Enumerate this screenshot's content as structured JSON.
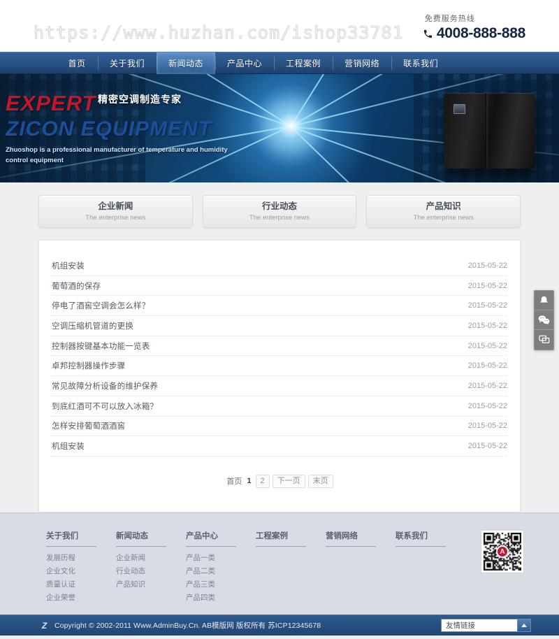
{
  "header": {
    "watermark": "https://www.huzhan.com/ishop33781",
    "hotline_label": "免费服务热线",
    "hotline_number": "4008-888-888",
    "phone_icon": "phone-icon"
  },
  "nav": {
    "items": [
      {
        "label": "首页",
        "active": false
      },
      {
        "label": "关于我们",
        "active": false
      },
      {
        "label": "新闻动态",
        "active": true
      },
      {
        "label": "产品中心",
        "active": false
      },
      {
        "label": "工程案例",
        "active": false
      },
      {
        "label": "营销网络",
        "active": false
      },
      {
        "label": "联系我们",
        "active": false
      }
    ]
  },
  "banner": {
    "headline_red": "EXPERT",
    "headline_blue": "ZICON EQUIPMENT",
    "slogan_cn": "精密空调制造专家",
    "slogan_en": "Zhuoshop is a professional manufacturer of temperature and humidity control equipment"
  },
  "categories": [
    {
      "title": "企业新闻",
      "subtitle": "The enterprise news"
    },
    {
      "title": "行业动态",
      "subtitle": "The enterprise news"
    },
    {
      "title": "产品知识",
      "subtitle": "The enterprise news"
    }
  ],
  "news": {
    "items": [
      {
        "title": "机组安装",
        "date": "2015-05-22"
      },
      {
        "title": "葡萄酒的保存",
        "date": "2015-05-22"
      },
      {
        "title": "停电了酒窖空调会怎么样？",
        "date": "2015-05-22"
      },
      {
        "title": "空调压缩机管道的更换",
        "date": "2015-05-22"
      },
      {
        "title": "控制器按键基本功能一览表",
        "date": "2015-05-22"
      },
      {
        "title": "卓邦控制器操作步骤",
        "date": "2015-05-22"
      },
      {
        "title": "常见故障分析设备的维护保养",
        "date": "2015-05-22"
      },
      {
        "title": "到底红酒可不可以放入冰箱？",
        "date": "2015-05-22"
      },
      {
        "title": "怎样安排葡萄酒酒窖",
        "date": "2015-05-22"
      },
      {
        "title": "机组安装",
        "date": "2015-05-22"
      }
    ]
  },
  "pagination": {
    "first": "首页",
    "current": "1",
    "page2": "2",
    "next": "下一页",
    "last": "末页"
  },
  "side_widget": {
    "items": [
      {
        "icon": "bell-icon",
        "name": "notification-button"
      },
      {
        "icon": "wechat-icon",
        "name": "wechat-button"
      },
      {
        "icon": "chat-icon",
        "name": "online-chat-button"
      }
    ]
  },
  "footer": {
    "columns": [
      {
        "title": "关于我们",
        "links": [
          "发展历程",
          "企业文化",
          "质量认证",
          "企业荣誉"
        ]
      },
      {
        "title": "新闻动态",
        "links": [
          "企业新闻",
          "行业动态",
          "产品知识"
        ]
      },
      {
        "title": "产品中心",
        "links": [
          "产品一类",
          "产品二类",
          "产品三类",
          "产品四类"
        ]
      },
      {
        "title": "工程案例",
        "links": []
      },
      {
        "title": "营销网络",
        "links": []
      },
      {
        "title": "联系我们",
        "links": []
      }
    ],
    "qr_logo_text": "A"
  },
  "copyright": {
    "logo_text": "Z",
    "text": "Copyright © 2002-2011 Www.AdminBuy.Cn. AB模版网 版权所有 苏ICP12345678",
    "links_label": "友情链接"
  }
}
